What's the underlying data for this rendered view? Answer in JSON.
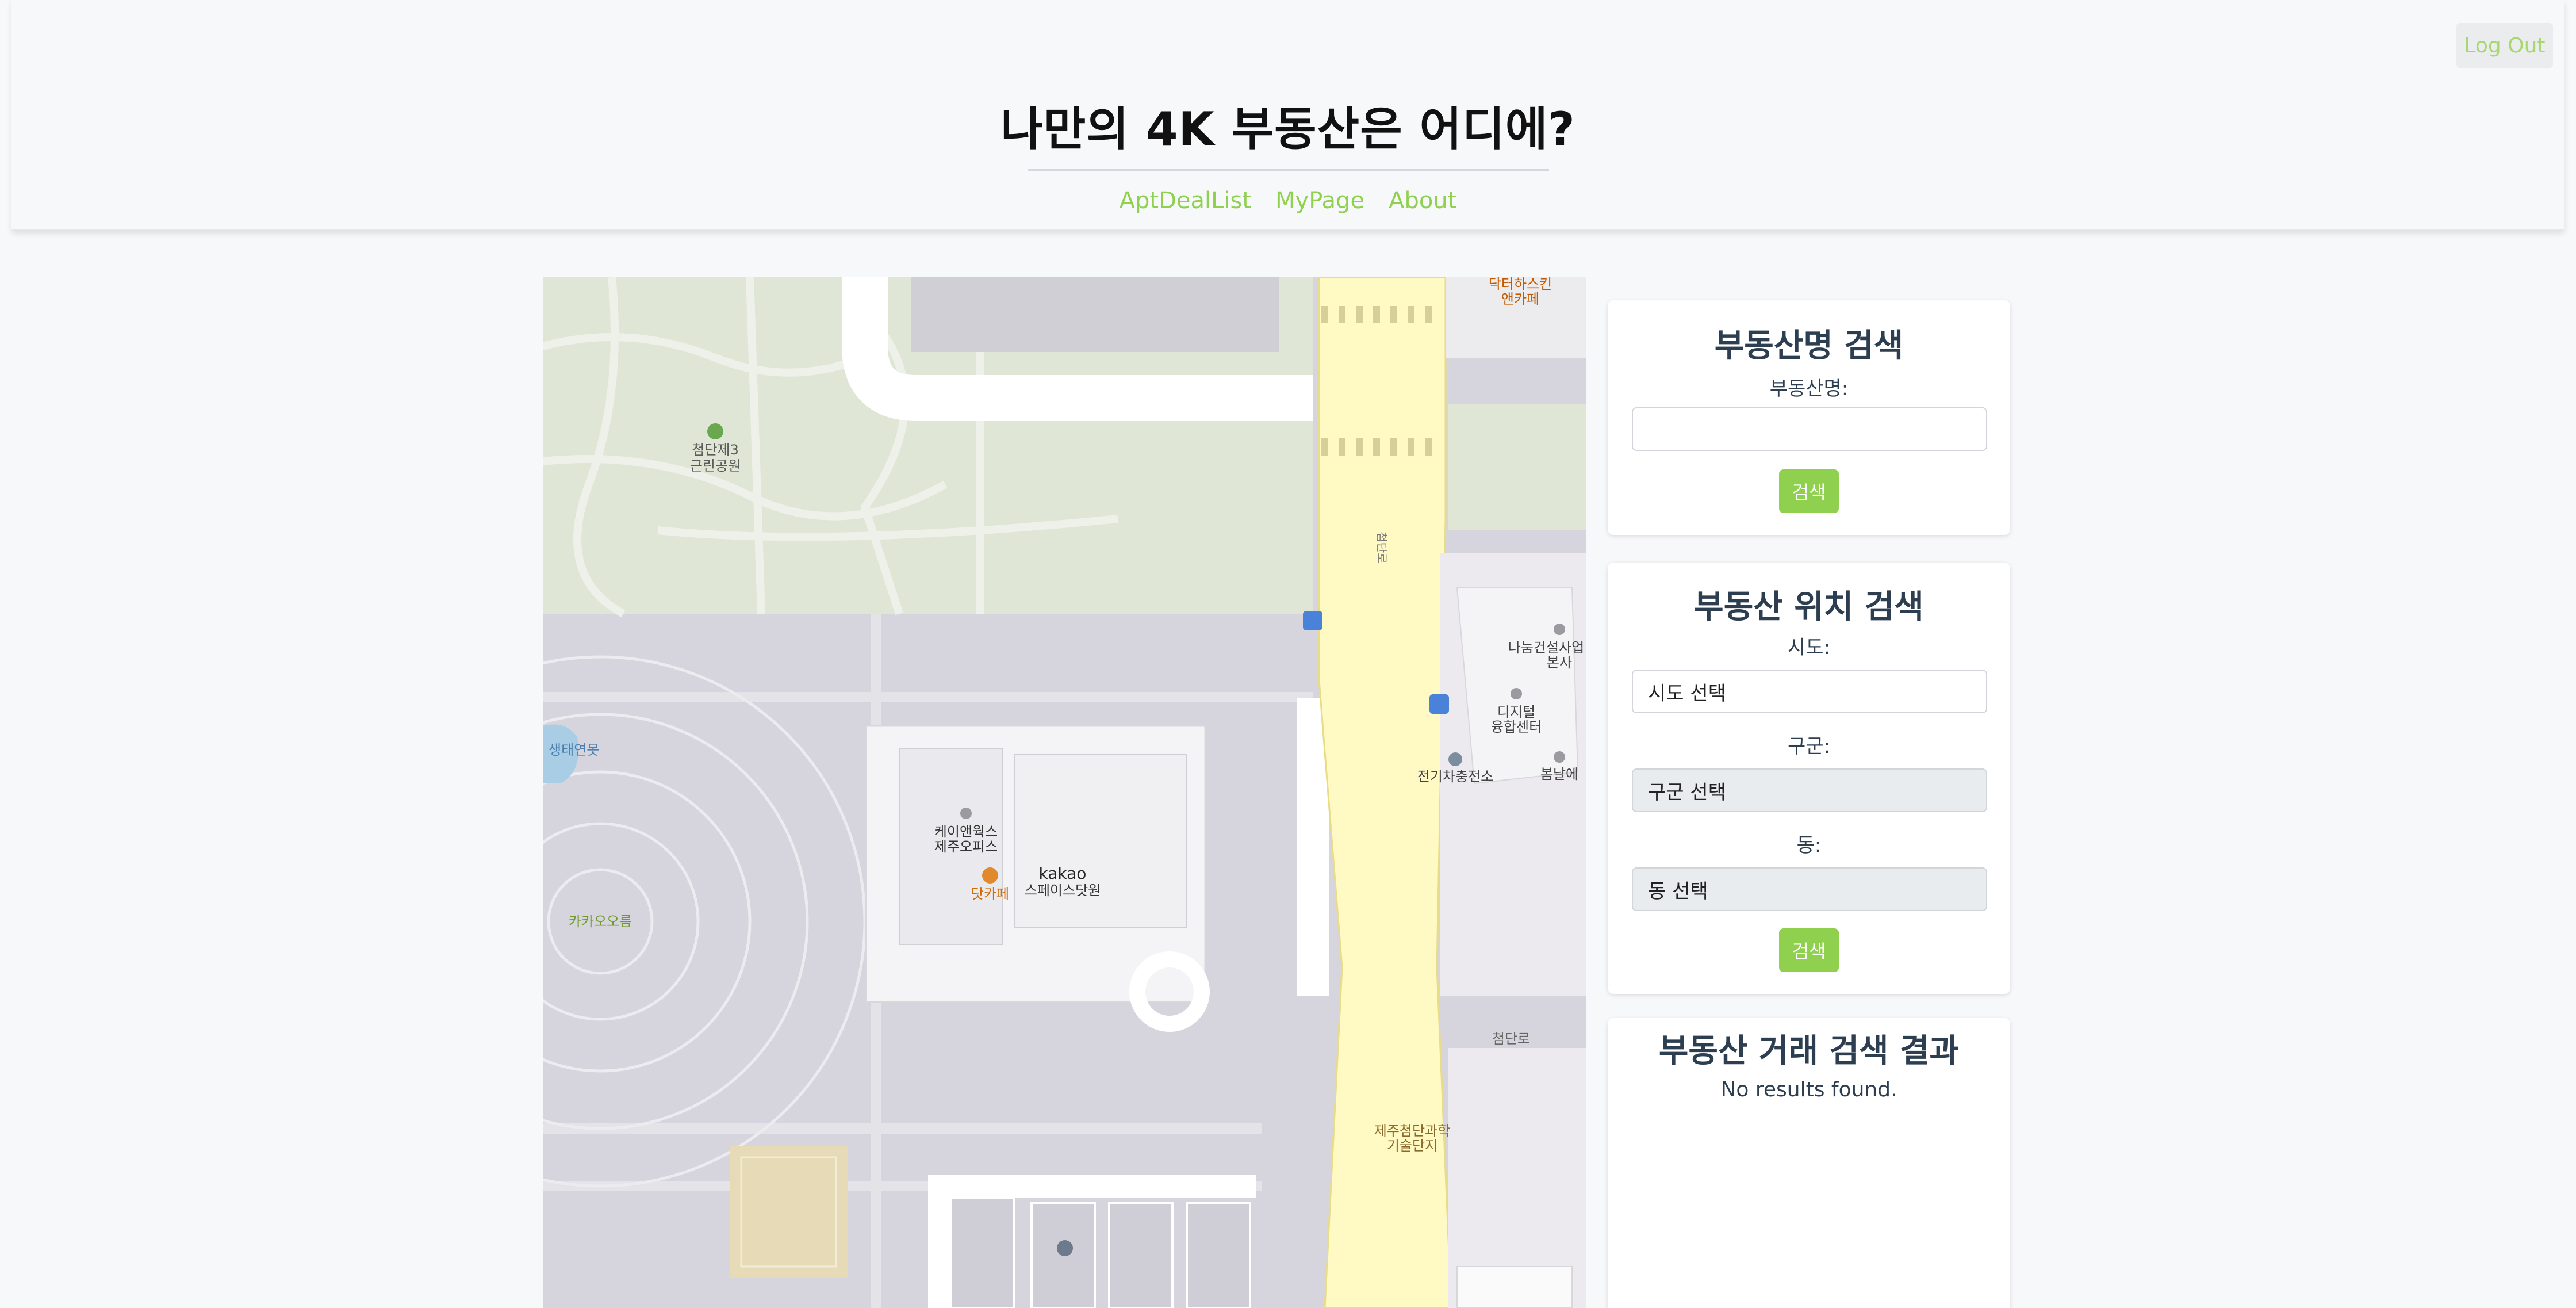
{
  "header": {
    "title": "나만의 4K 부동산은 어디에?",
    "logout_label": "Log Out",
    "nav": [
      "AptDealList",
      "MyPage",
      "About"
    ]
  },
  "map": {
    "labels": {
      "park": "첨단제3\n근린공원",
      "pond": "생태연못",
      "orum": "카카오오름",
      "kakao_office": "케이앤웍스\n제주오피스",
      "kakao_space": "kakao\n스페이스닷원",
      "cafe": "닷카페",
      "doctor": "닥터하스킨\n앤카페",
      "nanum": "나눔건설사업\n본사",
      "digital": "디지털\n융합센터",
      "ev": "전기차충전소",
      "bomnal": "봄날에",
      "road1": "첨단로",
      "road2": "첨단로",
      "complex": "제주첨단과학\n기술단지"
    }
  },
  "search_name": {
    "title": "부동산명 검색",
    "label": "부동산명:",
    "value": "",
    "button": "검색"
  },
  "search_location": {
    "title": "부동산 위치 검색",
    "sido_label": "시도:",
    "sido_value": "시도 선택",
    "gugun_label": "구군:",
    "gugun_value": "구군 선택",
    "dong_label": "동:",
    "dong_value": "동 선택",
    "button": "검색"
  },
  "results": {
    "title": "부동산 거래 검색 결과",
    "message": "No results found."
  },
  "colors": {
    "accent": "#8fd14f",
    "road": "#fff9c4",
    "park": "#dfe6d5"
  }
}
